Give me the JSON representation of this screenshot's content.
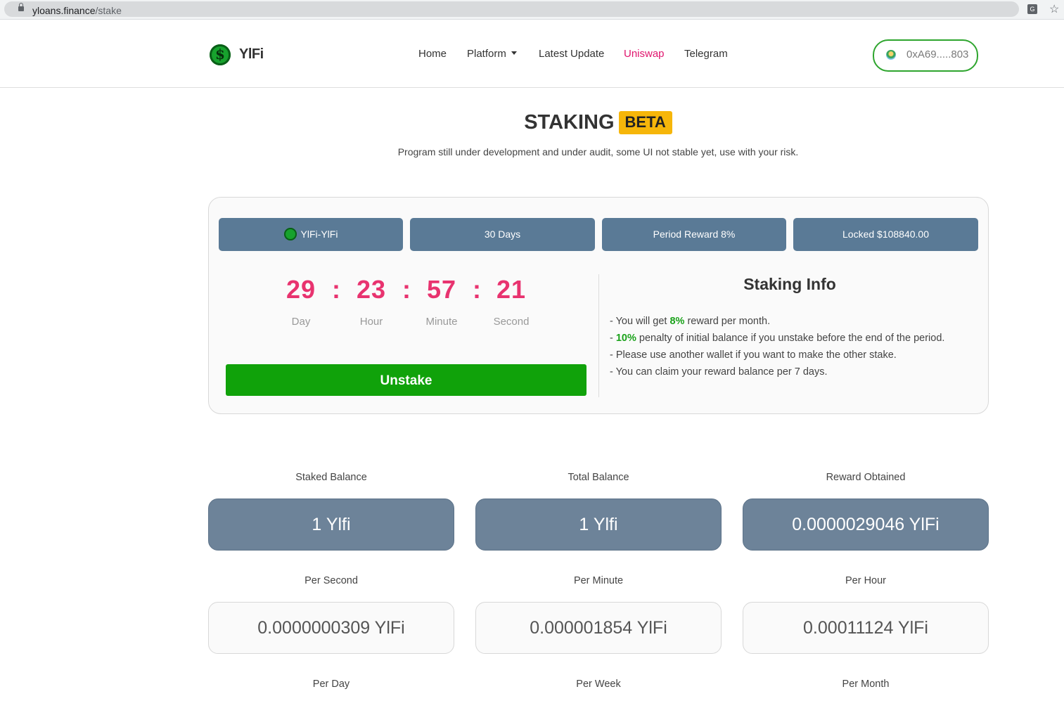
{
  "browser": {
    "url_host": "yloans.finance",
    "url_path": "/stake"
  },
  "nav": {
    "brand": "YlFi",
    "items": [
      "Home",
      "Platform",
      "Latest Update",
      "Uniswap",
      "Telegram"
    ],
    "active_item": "Uniswap",
    "wallet_address": "0xA69.....803"
  },
  "header": {
    "title": "STAKING",
    "badge": "BETA",
    "subtitle": "Program still under development and under audit, some UI not stable yet, use with your risk."
  },
  "stake_card": {
    "pills": [
      "YlFi-YlFi",
      "30 Days",
      "Period Reward 8%",
      "Locked $108840.00"
    ],
    "countdown": [
      {
        "value": "29",
        "label": "Day"
      },
      {
        "value": "23",
        "label": "Hour"
      },
      {
        "value": "57",
        "label": "Minute"
      },
      {
        "value": "21",
        "label": "Second"
      }
    ],
    "separator": ":",
    "unstake_label": "Unstake",
    "info_title": "Staking Info",
    "info_lines": [
      {
        "prefix": "- You will get ",
        "highlight": "8%",
        "suffix": " reward per month."
      },
      {
        "prefix": "- ",
        "highlight": "10%",
        "suffix": " penalty of initial balance if you unstake before the end of the period."
      },
      {
        "prefix": "- Please use another wallet if you want to make the other stake.",
        "highlight": "",
        "suffix": ""
      },
      {
        "prefix": "- You can claim your reward balance per 7 days.",
        "highlight": "",
        "suffix": ""
      }
    ]
  },
  "stats": {
    "balances": [
      {
        "label": "Staked Balance",
        "value": "1 Ylfi"
      },
      {
        "label": "Total Balance",
        "value": "1 Ylfi"
      },
      {
        "label": "Reward Obtained",
        "value": "0.0000029046 YlFi"
      }
    ],
    "rates": [
      {
        "label": "Per Second",
        "value": "0.0000000309 YlFi"
      },
      {
        "label": "Per Minute",
        "value": "0.000001854 YlFi"
      },
      {
        "label": "Per Hour",
        "value": "0.00011124 YlFi"
      }
    ],
    "more_labels": [
      "Per Day",
      "Per Week",
      "Per Month"
    ]
  },
  "colors": {
    "accent_pink": "#e8336f",
    "unstake_green": "#10a20a",
    "pill_blue": "#5a7a96",
    "beta_yellow": "#f6b60a"
  }
}
